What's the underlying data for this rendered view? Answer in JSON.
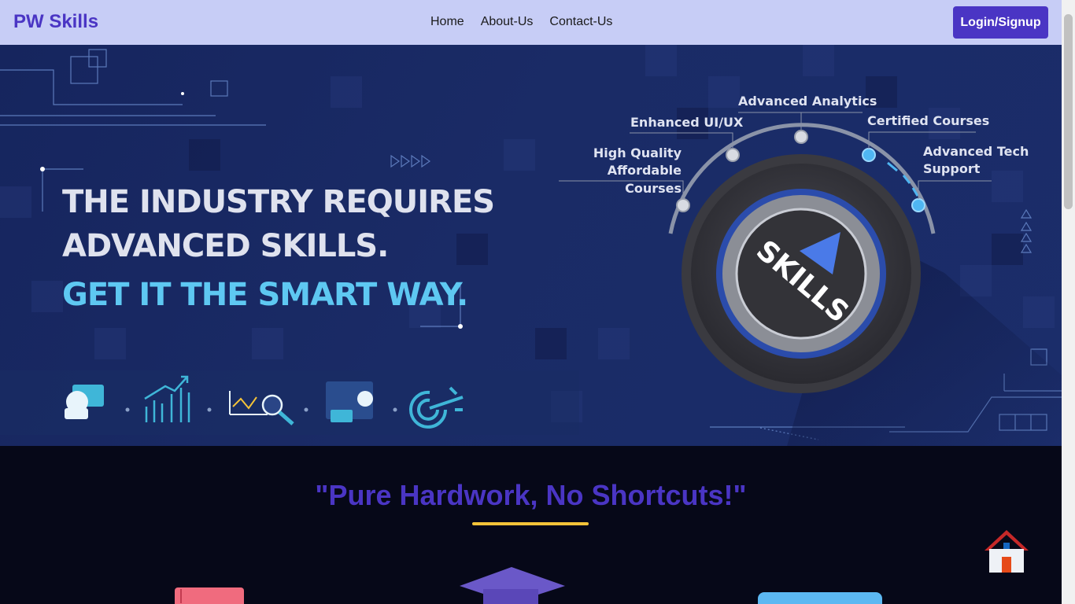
{
  "nav": {
    "brand": "PW Skills",
    "links": [
      "Home",
      "About-Us",
      "Contact-Us"
    ],
    "login_label": "Login/Signup"
  },
  "hero": {
    "headline_line1": "THE INDUSTRY REQUIRES",
    "headline_line2": "ADVANCED SKILLS.",
    "headline_line3": "GET IT THE SMART WAY.",
    "dial_text": "SKILLS",
    "features": [
      "High Quality\nAffordable Courses",
      "Enhanced UI/UX",
      "Advanced Analytics",
      "Certified Courses",
      "Advanced Tech\nSupport"
    ],
    "strip_icons": [
      "developer-laptop-icon",
      "growth-chart-icon",
      "data-analysis-icon",
      "presentation-icon",
      "target-icon"
    ]
  },
  "content": {
    "quote": "\"Pure Hardwork, No Shortcuts!\"",
    "home_icon": "home-icon"
  },
  "colors": {
    "brand": "#4a35c4",
    "nav_bg": "#c7cdf6",
    "hero_bg": "#16255e",
    "accent_cyan": "#5ec8f2",
    "quote_underline": "#f4c339",
    "page_bg": "#060818"
  }
}
